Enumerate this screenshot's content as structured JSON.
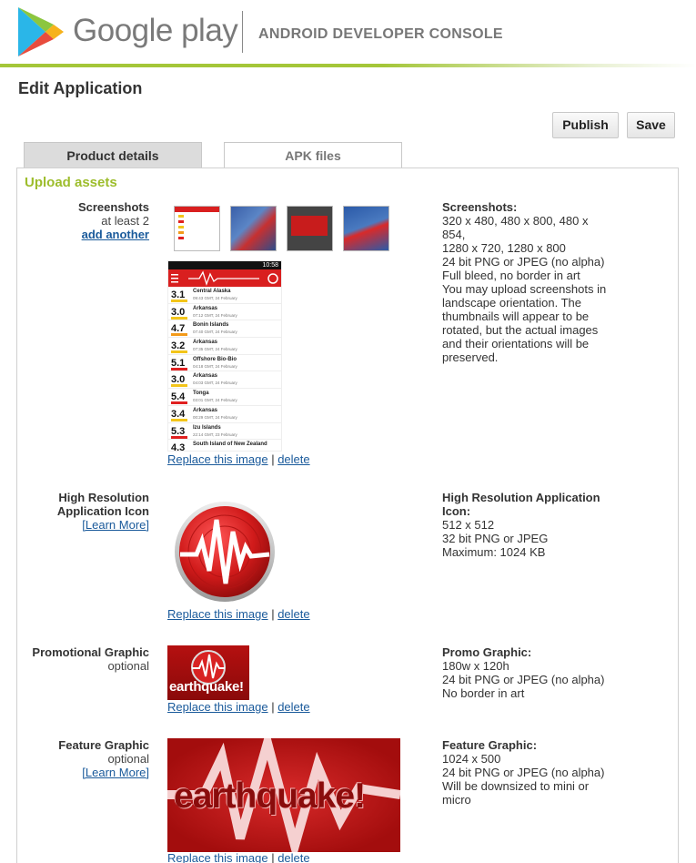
{
  "header": {
    "logo_text": "Google play",
    "console_title": "ANDROID DEVELOPER CONSOLE"
  },
  "page": {
    "title": "Edit Application"
  },
  "toolbar": {
    "publish_label": "Publish",
    "save_label": "Save"
  },
  "tabs": [
    {
      "label": "Product details",
      "active": true
    },
    {
      "label": "APK files",
      "active": false
    }
  ],
  "section_title": "Upload assets",
  "actions": {
    "replace": "Replace this image",
    "sep": "|",
    "delete": "delete"
  },
  "screenshots": {
    "label": "Screenshots",
    "sub": "at least 2",
    "link": "add another",
    "info_title": "Screenshots:",
    "info_lines": [
      "320 x 480, 480 x 800, 480 x",
      "854,",
      "1280 x 720, 1280 x 800",
      "24 bit PNG or JPEG (no alpha)",
      "Full bleed, no border in art",
      "You may upload screenshots in",
      "landscape orientation. The",
      "thumbnails will appear to be",
      "rotated, but the actual images",
      "and their orientations will be",
      "preserved."
    ],
    "phone_time": "10:58",
    "quakes": [
      {
        "mag": "3.1",
        "place": "Central Alaska",
        "date": "09:43 GMT, 24 February",
        "color": "#f3c51a"
      },
      {
        "mag": "3.0",
        "place": "Arkansas",
        "date": "07:12 GMT, 24 February",
        "color": "#f3c51a"
      },
      {
        "mag": "4.7",
        "place": "Bonin Islands",
        "date": "07:40 GMT, 24 February",
        "color": "#f39a1a"
      },
      {
        "mag": "3.2",
        "place": "Arkansas",
        "date": "07:35 GMT, 24 February",
        "color": "#f3c51a"
      },
      {
        "mag": "5.1",
        "place": "Offshore Bio-Bio",
        "date": "04:18 GMT, 24 February",
        "color": "#e02020"
      },
      {
        "mag": "3.0",
        "place": "Arkansas",
        "date": "04:03 GMT, 24 February",
        "color": "#f3c51a"
      },
      {
        "mag": "5.4",
        "place": "Tonga",
        "date": "03:01 GMT, 24 February",
        "color": "#e02020"
      },
      {
        "mag": "3.4",
        "place": "Arkansas",
        "date": "00:29 GMT, 24 February",
        "color": "#f3c51a"
      },
      {
        "mag": "5.3",
        "place": "Izu Islands",
        "date": "22:14 GMT, 23 February",
        "color": "#e02020"
      },
      {
        "mag": "4.3",
        "place": "South Island of New Zealand",
        "date": "",
        "color": "#f39a1a"
      }
    ]
  },
  "hi_res_icon": {
    "label_lines": [
      "High Resolution",
      "Application Icon"
    ],
    "learn_more": "[Learn More]",
    "info_title_lines": [
      "High Resolution Application",
      "Icon:"
    ],
    "info_lines": [
      "512 x 512",
      "32 bit PNG or JPEG",
      "Maximum: 1024 KB"
    ]
  },
  "promo": {
    "label": "Promotional Graphic",
    "sub": "optional",
    "word": "earthquake!",
    "info_title": "Promo Graphic:",
    "info_lines": [
      "180w x 120h",
      "24 bit PNG or JPEG (no alpha)",
      "No border in art"
    ]
  },
  "feature": {
    "label": "Feature Graphic",
    "sub": "optional",
    "learn_more": "[Learn More]",
    "word": "earthquake!",
    "info_title": "Feature Graphic:",
    "info_lines": [
      "1024 x 500",
      "24 bit PNG or JPEG (no alpha)",
      "Will be downsized to mini or",
      "micro"
    ]
  },
  "colors": {
    "accent_green": "#a4c639",
    "section_green": "#9dbd2c",
    "link_blue": "#1a5a9b",
    "brand_red": "#d91f1f"
  }
}
